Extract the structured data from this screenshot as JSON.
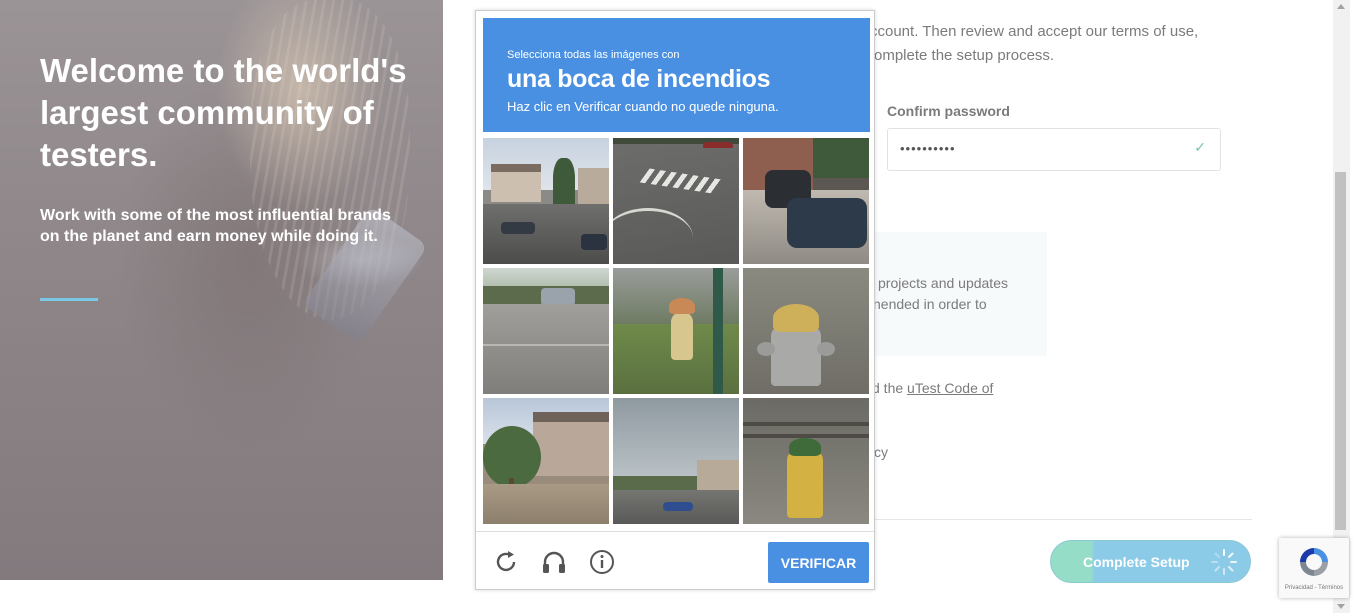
{
  "hero": {
    "title": "Welcome to the world's largest community of testers.",
    "subtitle": "Work with some of the most influential brands on the planet and earn money while doing it."
  },
  "form": {
    "intro_line1": "ccount. Then review and accept our terms of use,",
    "intro_line2": "omplete the setup process.",
    "confirm_password_label": "Confirm password",
    "confirm_password_value": "••••••••••",
    "info_line1": "projects and updates",
    "info_line2": "nended in order to",
    "code_prefix": "d the ",
    "code_link": "uTest Code of",
    "privacy_fragment": "cy",
    "complete_button": "Complete Setup"
  },
  "captcha": {
    "instruction_small": "Selecciona todas las imágenes con",
    "target": "una boca de incendios",
    "instruction_hint": "Haz clic en Verificar cuando no quede ninguna.",
    "verify_button": "VERIFICAR",
    "tiles": [
      {
        "row": 0,
        "col": 0,
        "scene": "street-houses-cars"
      },
      {
        "row": 0,
        "col": 1,
        "scene": "crosswalk"
      },
      {
        "row": 0,
        "col": 2,
        "scene": "parked-suvs"
      },
      {
        "row": 1,
        "col": 0,
        "scene": "parking-lot"
      },
      {
        "row": 1,
        "col": 1,
        "scene": "hydrant-pole"
      },
      {
        "row": 1,
        "col": 2,
        "scene": "hydrant-closeup"
      },
      {
        "row": 2,
        "col": 0,
        "scene": "house-tree"
      },
      {
        "row": 2,
        "col": 1,
        "scene": "road-sky"
      },
      {
        "row": 2,
        "col": 2,
        "scene": "hydrant-gravel"
      }
    ],
    "accent_color": "#4a90e2"
  },
  "badge": {
    "text": "Privacidad - Términos"
  }
}
